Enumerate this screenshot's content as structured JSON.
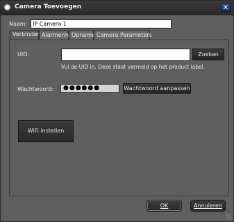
{
  "window": {
    "title": "Camera Toevoegen",
    "close_glyph": "✕"
  },
  "form": {
    "name_label": "Naam:",
    "name_value": "IP Camera 1"
  },
  "tabs": [
    {
      "label": "Verbinden",
      "active": true
    },
    {
      "label": "Alarmering",
      "active": false
    },
    {
      "label": "Opname",
      "active": false
    },
    {
      "label": "Camera Parameters",
      "active": false
    }
  ],
  "connect": {
    "uid_label": "UID:",
    "uid_value": "",
    "search_button": "Zoeken",
    "uid_hint": "Vul de UID in. Deze staat vermeld op het product label.",
    "password_label": "Wachtwoord:",
    "password_value": "●●●●●●",
    "change_password_button": "Wachtwoord aanpassen",
    "wifi_button": "WiFi instellen"
  },
  "footer": {
    "ok_button": "OK",
    "cancel_button": "Annuleren"
  },
  "icons": {
    "app": "camera-app-icon",
    "close": "close-icon"
  }
}
